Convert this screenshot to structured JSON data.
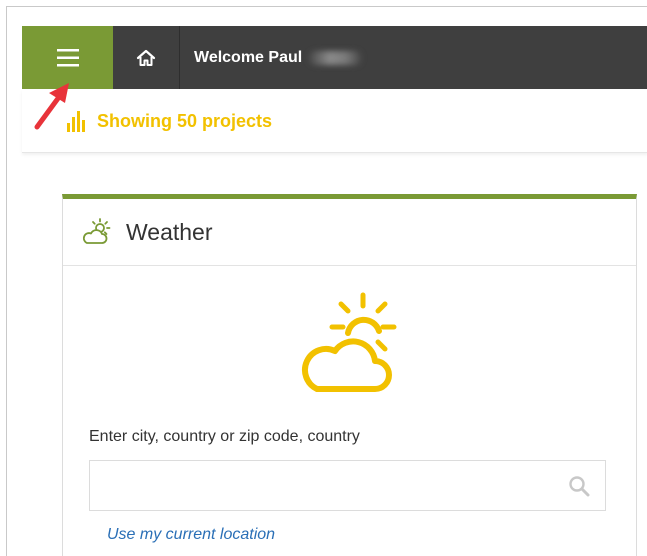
{
  "header": {
    "welcome_text": "Welcome Paul",
    "menu_icon": "hamburger-icon",
    "home_icon": "home-icon"
  },
  "projects": {
    "text": "Showing 50 projects",
    "icon": "bar-chart-icon"
  },
  "weather_card": {
    "title": "Weather",
    "prompt": "Enter city, country or zip code, country",
    "search_value": "",
    "search_icon": "search-icon",
    "location_link": "Use my current location"
  },
  "colors": {
    "accent_green": "#7a9a35",
    "topbar": "#3f3f3f",
    "yellow": "#f2c100",
    "link_blue": "#2a6fb6",
    "arrow_red": "#e8333a"
  }
}
